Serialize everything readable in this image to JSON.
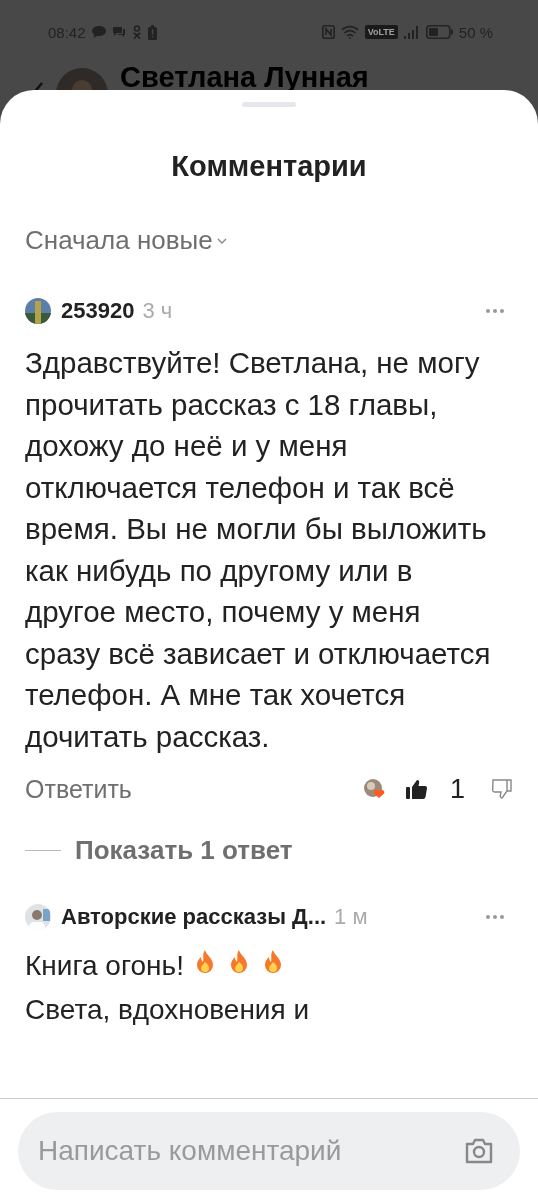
{
  "status_bar": {
    "time": "08:42",
    "network_badge": "VoLTE",
    "battery": "50 %"
  },
  "header": {
    "title": "Светлана Лунная"
  },
  "sheet": {
    "title": "Комментарии",
    "sort": {
      "label": "Сначала новые",
      "expanded": false
    }
  },
  "comments": [
    {
      "author": "253920",
      "time": "3 ч",
      "text": "Здравствуйте! Светлана, не могу прочитать рассказ с 18 главы, дохожу до неё и у меня отключается телефон и так всё время. Вы не могли бы выложить как нибудь по другому или в другое место, почему у меня сразу всё зависает и отключается телефон. А мне так хочется дочитать рассказ.",
      "reply_label": "Ответить",
      "liked": true,
      "likes": "1",
      "show_replies": "Показать 1 ответ"
    }
  ],
  "reply": {
    "author": "Авторские рассказы Д...",
    "time": "1 м",
    "lines": [
      {
        "text": "Книга огонь!",
        "emoji": [
          {
            "kind": "flame"
          },
          {
            "kind": "flame"
          },
          {
            "kind": "flame"
          }
        ]
      },
      {
        "text": "Света, вдохновения и"
      }
    ]
  },
  "composer": {
    "placeholder": "Написать комментарий"
  }
}
